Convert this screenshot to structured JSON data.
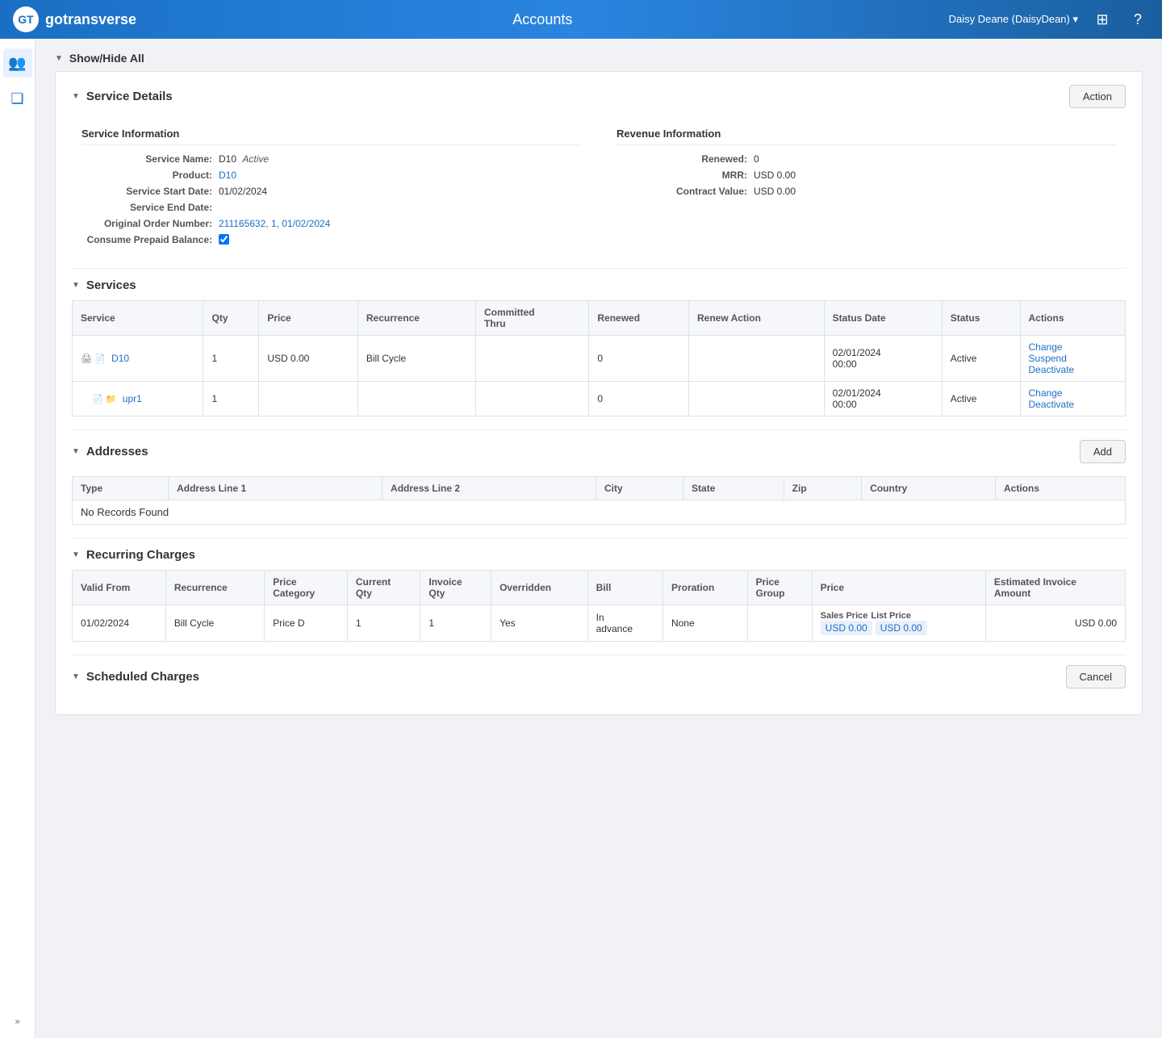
{
  "app": {
    "title": "Accounts",
    "logo_text": "gotransverse",
    "logo_initials": "GT"
  },
  "user": {
    "display": "Daisy Deane (DaisyDean) ▾"
  },
  "nav": {
    "show_hide_all": "Show/Hide All"
  },
  "service_details": {
    "section_title": "Service Details",
    "action_button": "Action",
    "service_info_title": "Service Information",
    "revenue_info_title": "Revenue Information",
    "fields": {
      "service_name_label": "Service Name:",
      "service_name_value": "D10",
      "service_name_status": "Active",
      "product_label": "Product:",
      "product_value": "D10",
      "service_start_date_label": "Service Start Date:",
      "service_start_date_value": "01/02/2024",
      "service_end_date_label": "Service End Date:",
      "service_end_date_value": "",
      "original_order_label": "Original Order Number:",
      "original_order_value": "211165632, 1, 01/02/2024",
      "consume_prepaid_label": "Consume Prepaid Balance:"
    },
    "revenue": {
      "renewed_label": "Renewed:",
      "renewed_value": "0",
      "mrr_label": "MRR:",
      "mrr_value": "USD 0.00",
      "contract_value_label": "Contract Value:",
      "contract_value_value": "USD 0.00"
    }
  },
  "services_section": {
    "title": "Services",
    "columns": [
      "Service",
      "Qty",
      "Price",
      "Recurrence",
      "Committed Thru",
      "Renewed",
      "Renew Action",
      "Status Date",
      "Status",
      "Actions"
    ],
    "rows": [
      {
        "service": "D10",
        "qty": "1",
        "price": "USD 0.00",
        "recurrence": "Bill Cycle",
        "committed_thru": "",
        "renewed": "0",
        "renew_action": "",
        "status_date": "02/01/2024 00:00",
        "status": "Active",
        "actions": [
          "Change",
          "Suspend",
          "Deactivate"
        ],
        "level": 1,
        "icons": [
          "print",
          "page"
        ]
      },
      {
        "service": "upr1",
        "qty": "1",
        "price": "",
        "recurrence": "",
        "committed_thru": "",
        "renewed": "0",
        "renew_action": "",
        "status_date": "02/01/2024 00:00",
        "status": "Active",
        "actions": [
          "Change",
          "Deactivate"
        ],
        "level": 2,
        "icons": [
          "page",
          "file"
        ]
      }
    ]
  },
  "addresses_section": {
    "title": "Addresses",
    "add_button": "Add",
    "columns": [
      "Type",
      "Address Line 1",
      "Address Line 2",
      "City",
      "State",
      "Zip",
      "Country",
      "Actions"
    ],
    "no_records": "No Records Found"
  },
  "recurring_charges": {
    "title": "Recurring Charges",
    "columns": [
      "Valid From",
      "Recurrence",
      "Price Category",
      "Current Qty",
      "Invoice Qty",
      "Overridden",
      "Bill",
      "Proration",
      "Price Group",
      "Price",
      "Estimated Invoice Amount"
    ],
    "price_sub_labels": [
      "Sales Price",
      "List Price"
    ],
    "rows": [
      {
        "valid_from": "01/02/2024",
        "recurrence": "Bill Cycle",
        "price_category": "Price D",
        "current_qty": "1",
        "invoice_qty": "1",
        "overridden": "Yes",
        "bill": "In advance",
        "proration": "None",
        "price_group": "",
        "sales_price": "USD 0.00",
        "list_price": "USD 0.00",
        "estimated_invoice": "USD 0.00"
      }
    ]
  },
  "scheduled_charges": {
    "title": "Scheduled Charges",
    "cancel_button": "Cancel"
  },
  "sidebar": {
    "items": [
      {
        "name": "users-icon",
        "symbol": "👥"
      },
      {
        "name": "copy-icon",
        "symbol": "⧉"
      }
    ],
    "expand_label": "»"
  }
}
